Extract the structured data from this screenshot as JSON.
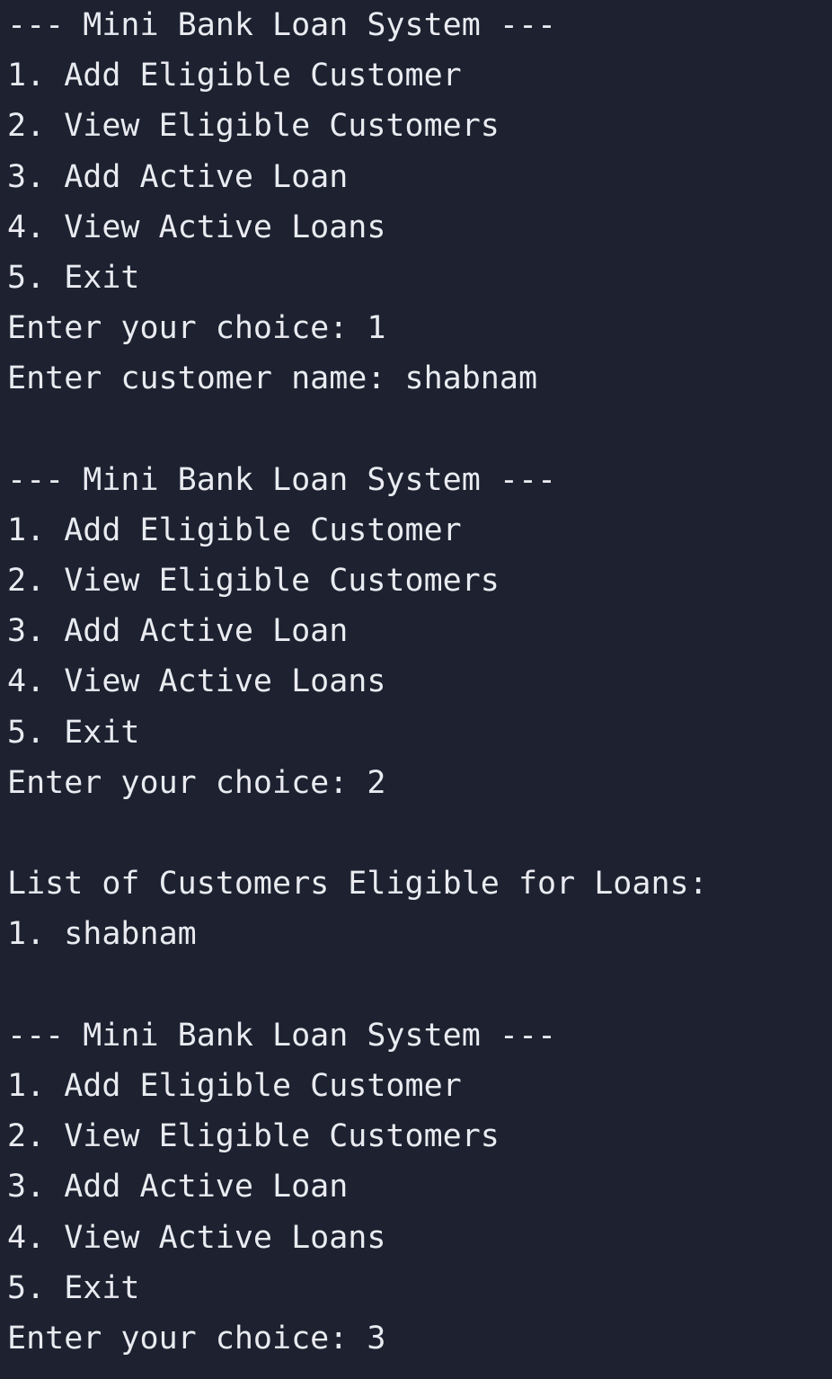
{
  "terminal": {
    "lines": [
      "--- Mini Bank Loan System ---",
      "1. Add Eligible Customer",
      "2. View Eligible Customers",
      "3. Add Active Loan",
      "4. View Active Loans",
      "5. Exit",
      "Enter your choice: 1",
      "Enter customer name: shabnam",
      "",
      "--- Mini Bank Loan System ---",
      "1. Add Eligible Customer",
      "2. View Eligible Customers",
      "3. Add Active Loan",
      "4. View Active Loans",
      "5. Exit",
      "Enter your choice: 2",
      "",
      "List of Customers Eligible for Loans:",
      "1. shabnam",
      "",
      "--- Mini Bank Loan System ---",
      "1. Add Eligible Customer",
      "2. View Eligible Customers",
      "3. Add Active Loan",
      "4. View Active Loans",
      "5. Exit",
      "Enter your choice: 3"
    ]
  }
}
